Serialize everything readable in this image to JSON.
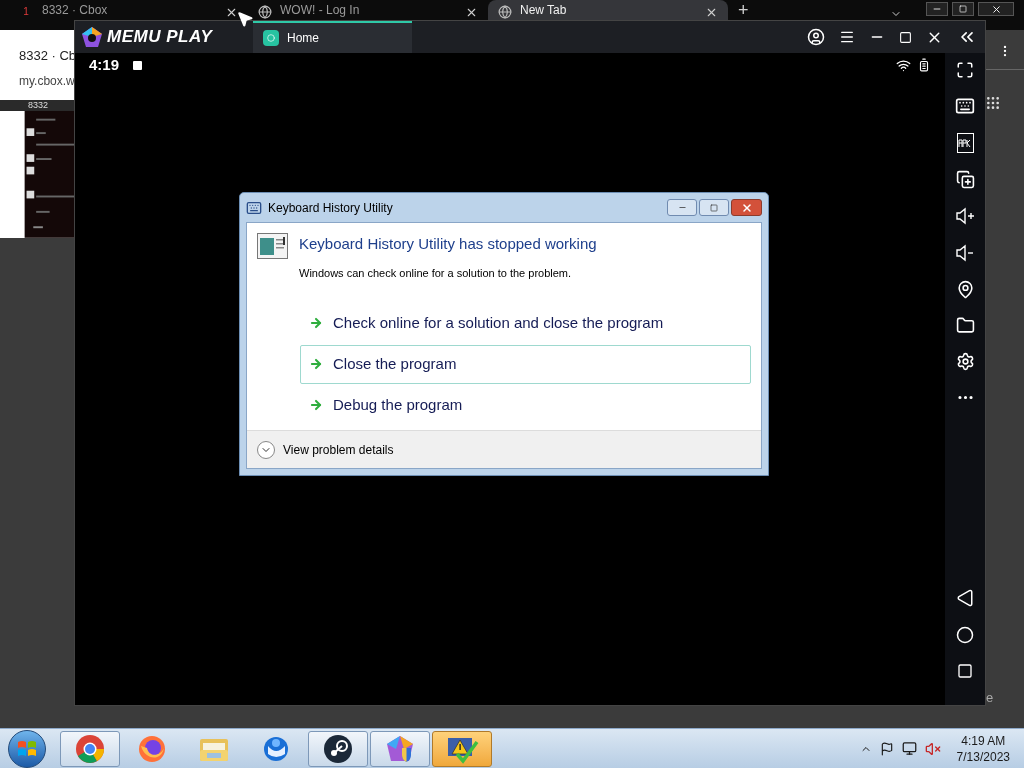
{
  "browser": {
    "tabs": [
      {
        "badge": "1",
        "title": "8332 · Cbox",
        "selected": false
      },
      {
        "title": "WOW! - Log In",
        "selected": false
      },
      {
        "title": "New Tab",
        "selected": true
      }
    ],
    "new_tab": "+"
  },
  "background_page": {
    "title": "8332 · Cb",
    "url": "my.cbox.w",
    "chat_header": "8332"
  },
  "memu": {
    "logo": "MEMU PLAY",
    "tab": "Home"
  },
  "android": {
    "time": "4:19"
  },
  "dialog": {
    "title": "Keyboard History Utility",
    "heading": "Keyboard History Utility has stopped working",
    "description": "Windows can check online for a solution to the problem.",
    "options": [
      {
        "label": "Check online for a solution and close the program",
        "selected": false
      },
      {
        "label": "Close the program",
        "selected": true
      },
      {
        "label": "Debug the program",
        "selected": false
      }
    ],
    "details": "View problem details"
  },
  "edge_text": "e",
  "taskbar": {
    "apps": [
      {
        "kind": "chrome",
        "running": true
      },
      {
        "kind": "firefox",
        "running": false
      },
      {
        "kind": "folder",
        "running": false
      },
      {
        "kind": "thunderbird",
        "running": false
      },
      {
        "kind": "steam",
        "running": true
      },
      {
        "kind": "memu",
        "running": true
      },
      {
        "kind": "alert",
        "running": true
      }
    ],
    "time": "4:19 AM",
    "date": "7/13/2023"
  }
}
